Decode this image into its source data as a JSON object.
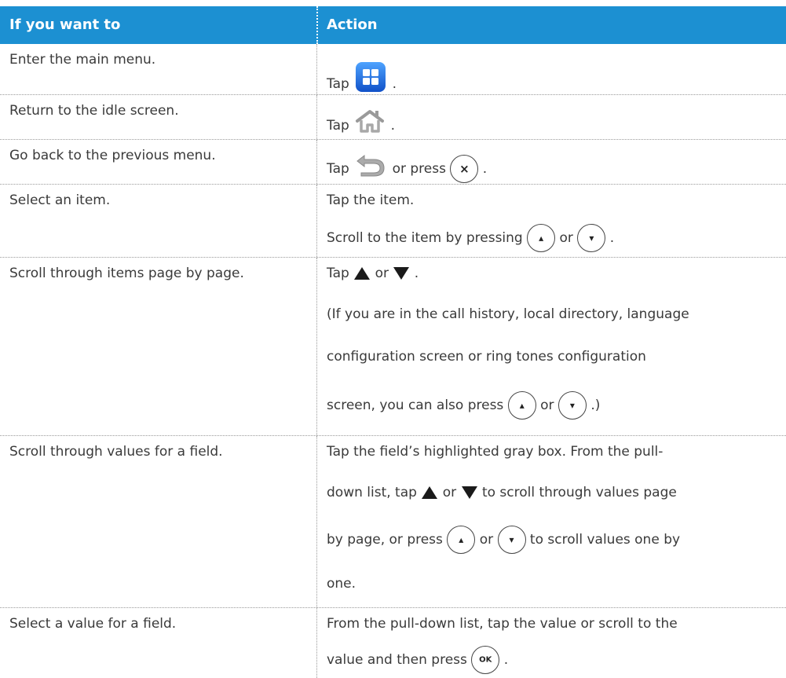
{
  "header": {
    "col1": "If you want to",
    "col2": "Action"
  },
  "rows": [
    {
      "label": "Enter the main menu.",
      "a1": "Tap",
      "a2": "."
    },
    {
      "label": "Return to the idle screen.",
      "a1": "Tap",
      "a2": "."
    },
    {
      "label": "Go back to the previous menu.",
      "a1": "Tap",
      "a2": "or press",
      "a3": "."
    },
    {
      "label": "Select an item.",
      "l1": "Tap the item.",
      "l2a": "Scroll to the item by pressing",
      "l2b": "or",
      "l2c": "."
    },
    {
      "label": "Scroll through items page by page.",
      "l1a": "Tap",
      "l1b": "or",
      "l1c": ".",
      "l2": "(If you are in the call history, local directory, language",
      "l3": "configuration screen or ring tones configuration",
      "l4a": "screen, you can also press",
      "l4b": "or",
      "l4c": ".)"
    },
    {
      "label": "Scroll through values for a field.",
      "l1": "Tap the field’s highlighted gray box. From the pull-",
      "l2a": "down list, tap",
      "l2b": "or",
      "l2c": "to scroll through values page",
      "l3a": "by page, or press",
      "l3b": "or",
      "l3c": "to scroll values one by",
      "l4": "one."
    },
    {
      "label": "Select a value for a field.",
      "l1": "From the pull-down list, tap the value or scroll to the",
      "l2a": "value and then press",
      "l2b": "."
    }
  ],
  "icons": {
    "ok": "OK",
    "x": "×",
    "up": "▴",
    "down": "▾"
  },
  "colors": {
    "header": "#1c90d2",
    "menu_icon": "#1f6fe0"
  }
}
